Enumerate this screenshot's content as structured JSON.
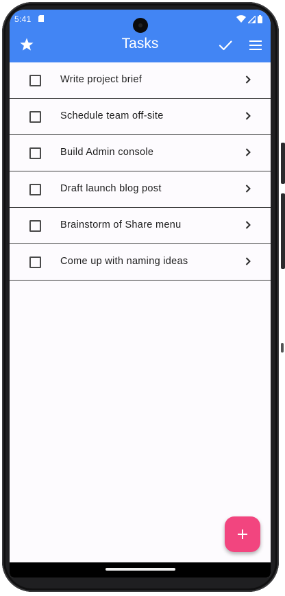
{
  "status_bar": {
    "time": "5:41",
    "icons": [
      "sd-card-icon",
      "wifi-icon",
      "signal-icon",
      "battery-icon"
    ]
  },
  "app_bar": {
    "title": "Tasks",
    "color": "#4285f4",
    "actions": [
      "star-icon",
      "check-icon",
      "menu-icon"
    ]
  },
  "tasks": [
    {
      "label": "Write project brief",
      "checked": false
    },
    {
      "label": "Schedule team off-site",
      "checked": false
    },
    {
      "label": "Build Admin console",
      "checked": false
    },
    {
      "label": "Draft launch blog post",
      "checked": false
    },
    {
      "label": "Brainstorm of Share menu",
      "checked": false
    },
    {
      "label": "Come up with naming ideas",
      "checked": false
    }
  ],
  "fab": {
    "icon": "plus-icon",
    "color": "#f2457f"
  }
}
